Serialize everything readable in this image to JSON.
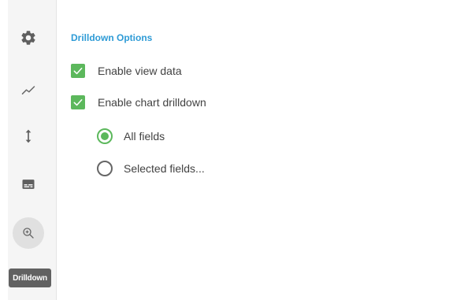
{
  "rail": {
    "items": [
      {
        "icon": "gear-icon"
      },
      {
        "icon": "line-chart-icon"
      },
      {
        "icon": "vertical-arrows-icon"
      },
      {
        "icon": "subtitles-icon"
      },
      {
        "icon": "zoom-in-icon",
        "active": true
      }
    ],
    "tooltip": "Drilldown"
  },
  "panel": {
    "title": "Drilldown Options",
    "enable_view_data": {
      "label": "Enable view data",
      "checked": true
    },
    "enable_chart_drilldown": {
      "label": "Enable chart drilldown",
      "checked": true
    },
    "radio_all_fields": {
      "label": "All fields",
      "selected": true
    },
    "radio_selected_fields": {
      "label": "Selected fields...",
      "selected": false
    }
  },
  "colors": {
    "accent_blue": "#2e9bd6",
    "check_green": "#5cb85c",
    "text": "#424242",
    "tooltip_bg": "#616161"
  }
}
